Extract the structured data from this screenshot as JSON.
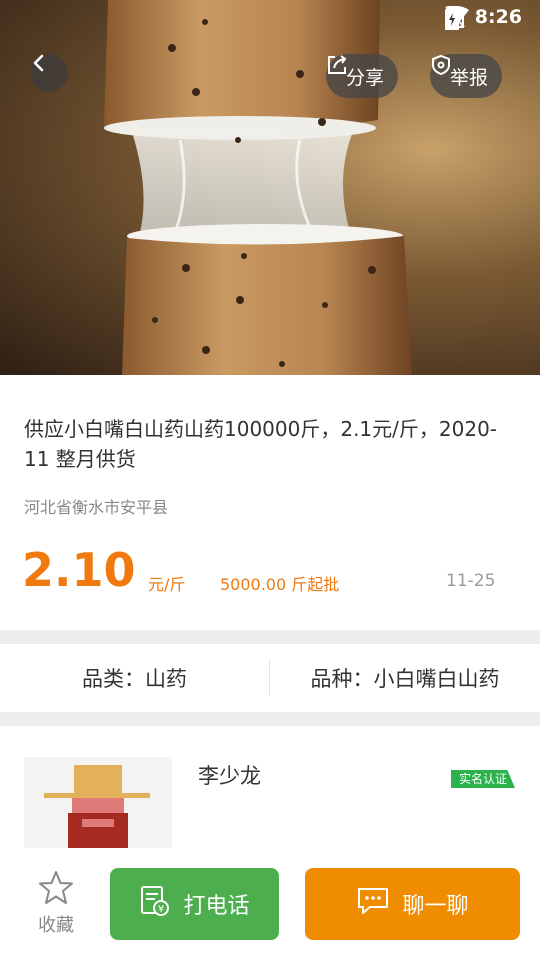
{
  "status": {
    "time": "8:26"
  },
  "hero": {
    "share_label": "分享",
    "report_label": "举报"
  },
  "product": {
    "title": "供应小白嘴白山药山药100000斤，2.1元/斤，2020-11 整月供货",
    "location": "河北省衡水市安平县",
    "price": "2.10",
    "price_unit": "元/斤",
    "moq": "5000.00 斤起批",
    "date": "11-25"
  },
  "specs": {
    "category": "品类：山药",
    "variety": "品种：小白嘴白山药"
  },
  "seller": {
    "name": "李少龙",
    "badge": "实名认证"
  },
  "bottom": {
    "favorite_label": "收藏",
    "call_label": "打电话",
    "chat_label": "聊一聊"
  },
  "colors": {
    "accent_orange": "#f07a10",
    "call_green": "#4cae4c",
    "chat_orange": "#f08c00",
    "verified_green": "#2bb24c"
  },
  "icons": [
    "back-icon",
    "share-icon",
    "report-shield-icon",
    "wifi-icon",
    "no-sim-icon",
    "battery-icon",
    "star-icon",
    "phone-bill-icon",
    "chat-icon"
  ]
}
